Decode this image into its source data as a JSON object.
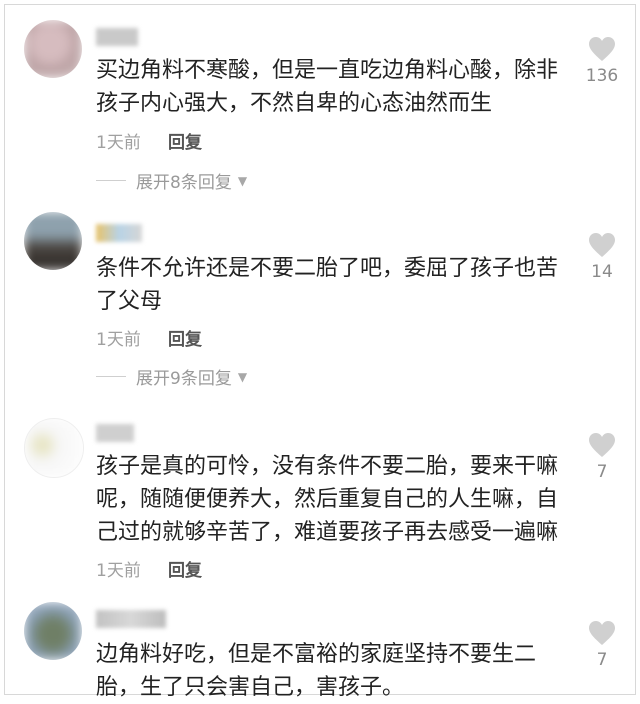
{
  "comments": [
    {
      "text": "买边角料不寒酸，但是一直吃边角料心酸，除非\n孩子内心强大，不然自卑的心态油然而生",
      "time": "1天前",
      "reply_label": "回复",
      "expand_label": "展开8条回复",
      "likes": "136",
      "avatar_colors": [
        "#cbb3b5",
        "#e7d6d6"
      ]
    },
    {
      "text": "条件不允许还是不要二胎了吧，委屈了孩子也苦\n了父母",
      "time": "1天前",
      "reply_label": "回复",
      "expand_label": "展开9条回复",
      "likes": "14",
      "avatar_colors": [
        "#6b7c8a",
        "#3f3a36"
      ]
    },
    {
      "text": "孩子是真的可怜，没有条件不要二胎，要来干嘛\n呢，随随便便养大，然后重复自己的人生嘛，自\n己过的就够辛苦了，难道要孩子再去感受一遍嘛",
      "time": "1天前",
      "reply_label": "回复",
      "likes": "7",
      "avatar_colors": [
        "#f2f2f2",
        "#ffffff"
      ]
    },
    {
      "text": "边角料好吃，但是不富裕的家庭坚持不要生二\n胎，生了只会害自己，害孩子。",
      "likes": "7",
      "avatar_colors": [
        "#7a8c6e",
        "#5b6f86"
      ]
    }
  ]
}
